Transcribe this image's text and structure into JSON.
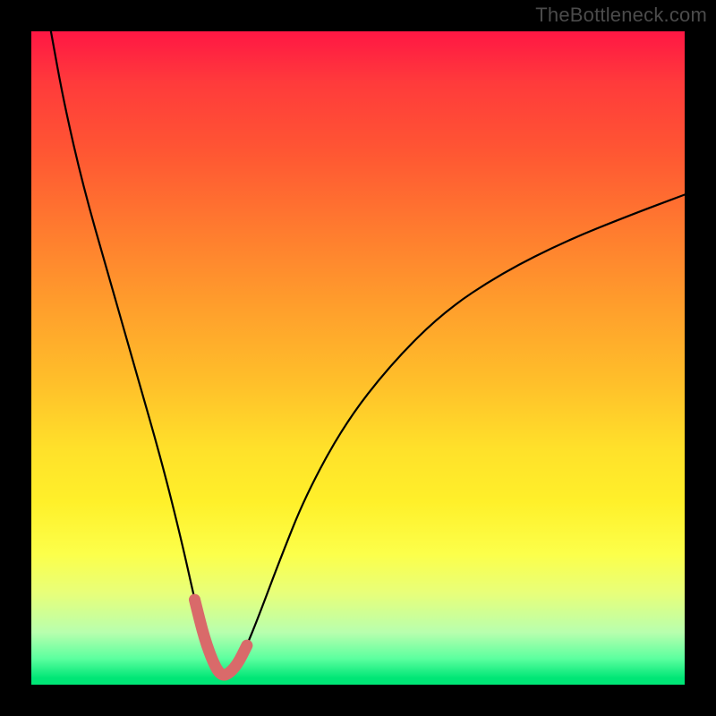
{
  "watermark": "TheBottleneck.com",
  "colors": {
    "page_bg": "#000000",
    "curve_stroke": "#000000",
    "highlight_stroke": "#d96a6a",
    "gradient_top": "#ff1744",
    "gradient_mid": "#ffe12a",
    "gradient_bottom": "#00e676"
  },
  "chart_data": {
    "type": "line",
    "title": "",
    "xlabel": "",
    "ylabel": "",
    "xlim": [
      0,
      100
    ],
    "ylim": [
      0,
      100
    ],
    "annotations": [],
    "series": [
      {
        "name": "bottleneck-curve",
        "x": [
          3,
          5,
          8,
          12,
          16,
          20,
          23,
          25,
          26.5,
          28,
          29,
          30,
          31.5,
          33,
          35,
          38,
          42,
          48,
          55,
          63,
          72,
          82,
          92,
          100
        ],
        "y": [
          100,
          89,
          76,
          62,
          48,
          34,
          22,
          13,
          7,
          3,
          1.5,
          1.5,
          3,
          6,
          11,
          19,
          29,
          40,
          49,
          57,
          63,
          68,
          72,
          75
        ]
      },
      {
        "name": "highlight-valley",
        "x": [
          25,
          26.5,
          28,
          29,
          30,
          31.5,
          33
        ],
        "y": [
          13,
          7,
          3,
          1.5,
          1.5,
          3,
          6
        ]
      }
    ]
  }
}
